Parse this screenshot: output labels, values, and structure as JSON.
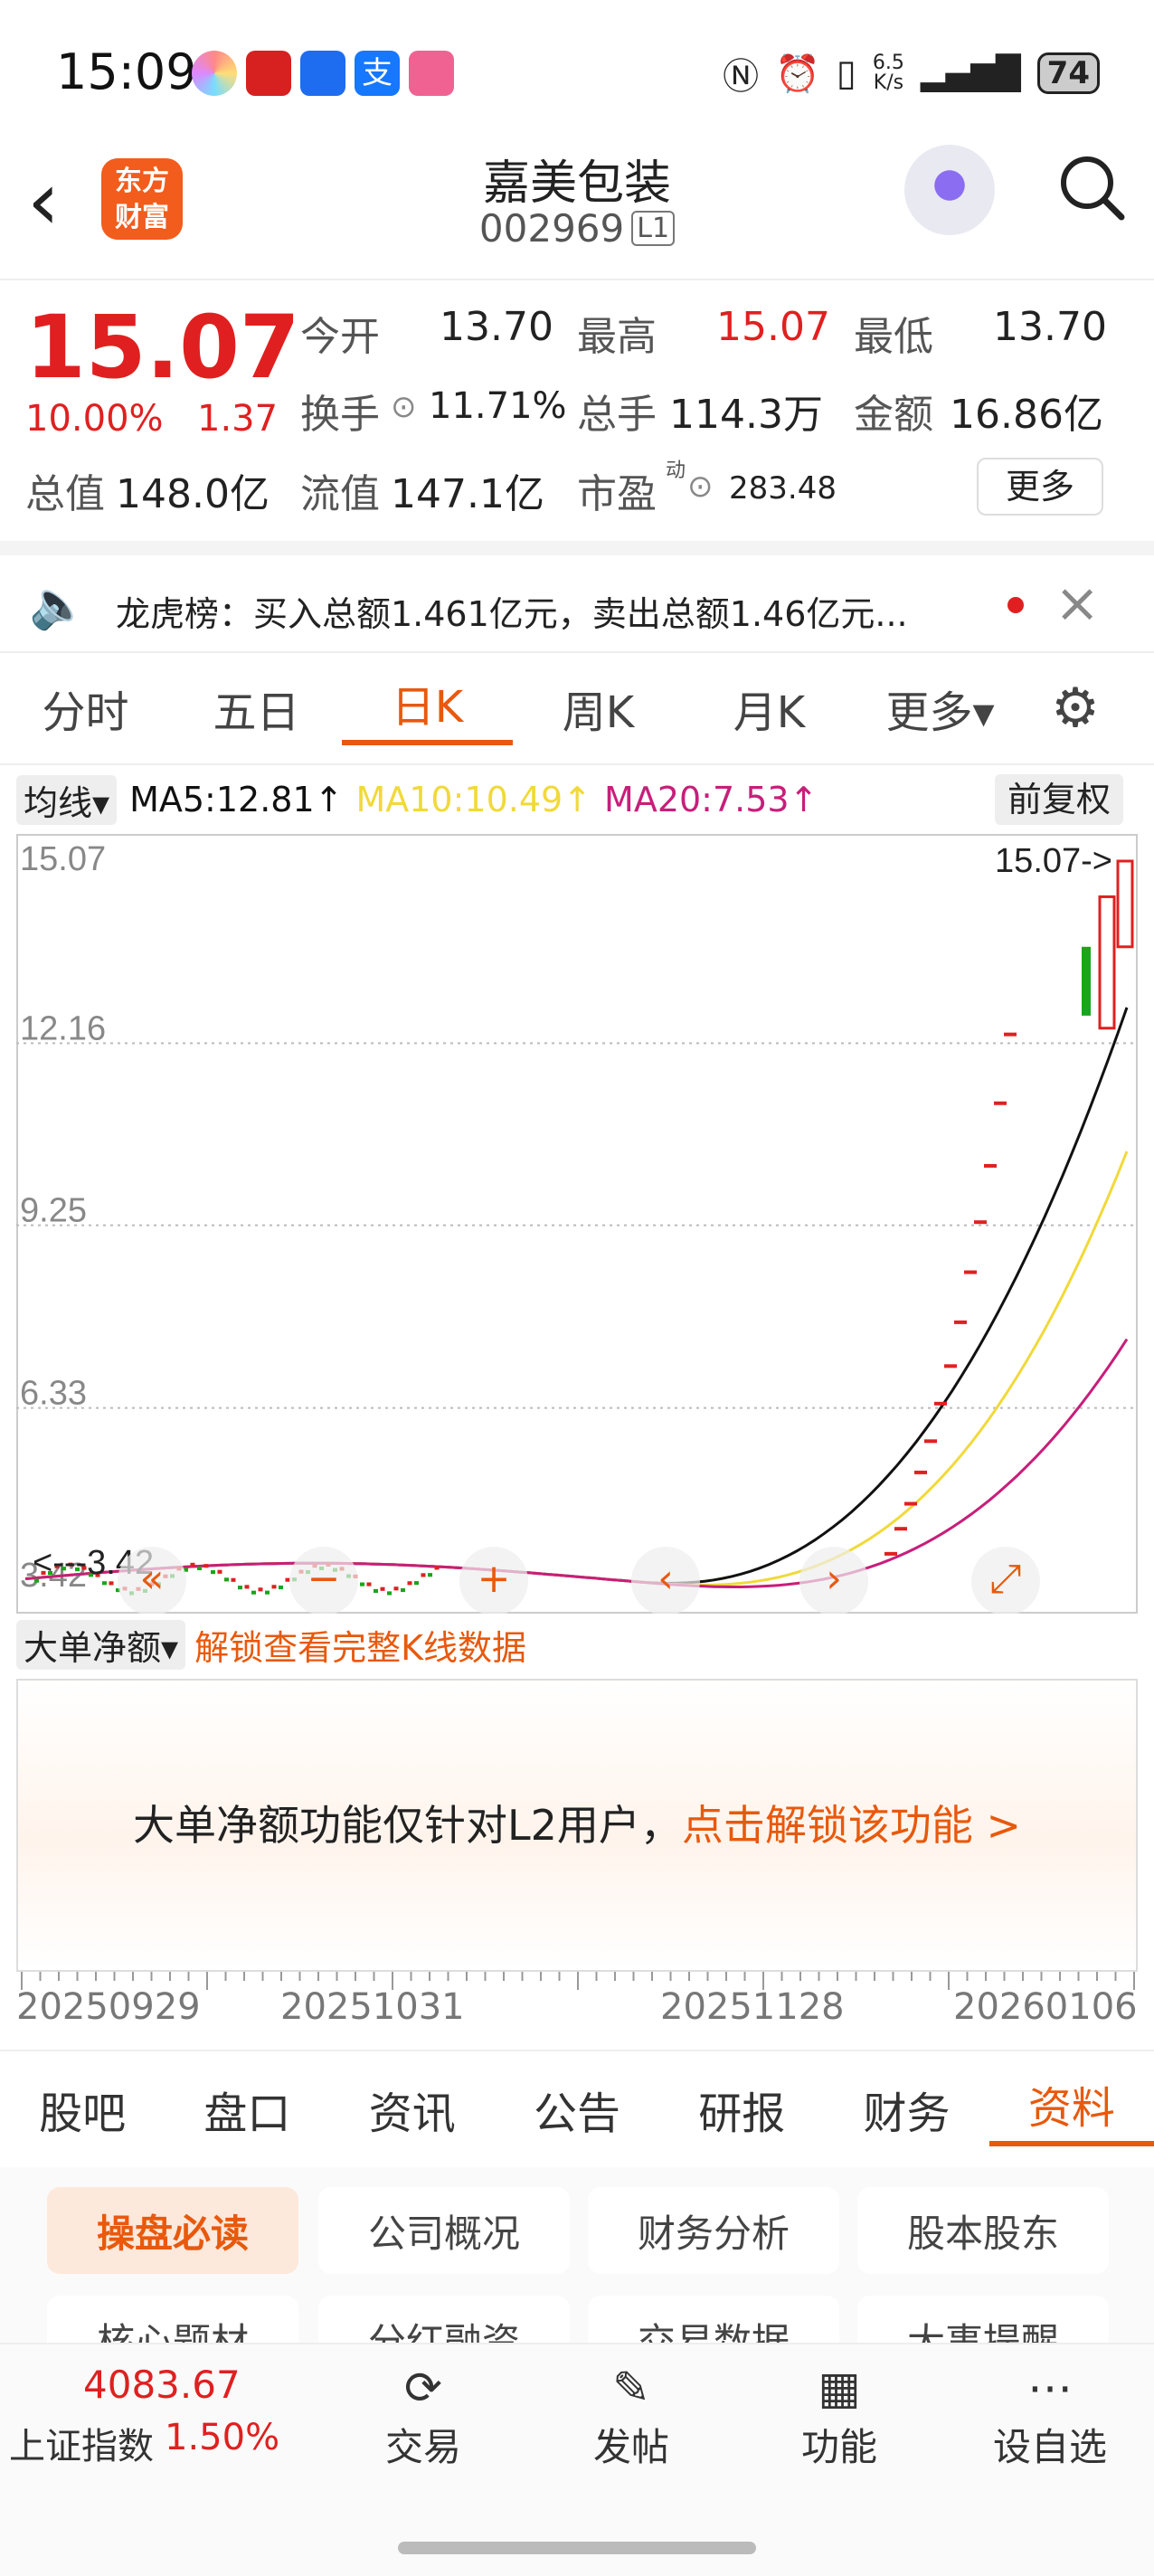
{
  "status_bar": {
    "time": "15:09",
    "net_speed_top": "6.5",
    "net_speed_bottom": "K/s",
    "battery": "74"
  },
  "header": {
    "title": "嘉美包装",
    "code": "002969",
    "level": "L1",
    "logo_line1": "东方",
    "logo_line2": "财富"
  },
  "quote": {
    "price": "15.07",
    "change_pct": "10.00%",
    "change": "1.37",
    "open_label": "今开",
    "open": "13.70",
    "high_label": "最高",
    "high": "15.07",
    "low_label": "最低",
    "low": "13.70",
    "turnover_label": "换手",
    "turnover": "11.71%",
    "volume_label": "总手",
    "volume": "114.3万",
    "amount_label": "金额",
    "amount": "16.86亿",
    "mktcap_label": "总值",
    "mktcap": "148.0亿",
    "float_label": "流值",
    "float_cap": "147.1亿",
    "pe_label": "市盈",
    "pe_sup": "动",
    "pe": "283.48",
    "more": "更多"
  },
  "lhb": {
    "text": "龙虎榜：买入总额1.461亿元，卖出总额1.46亿元..."
  },
  "tabs": [
    "分时",
    "五日",
    "日K",
    "周K",
    "月K",
    "更多▾"
  ],
  "ma": {
    "selector": "均线▾",
    "ma5": "MA5:12.81↑",
    "ma10": "MA10:10.49↑",
    "ma20": "MA20:7.53↑",
    "adjust": "前复权"
  },
  "chart_data": {
    "type": "candlestick",
    "y_ticks": [
      "15.07",
      "12.16",
      "9.25",
      "6.33",
      "3.42"
    ],
    "max_label": "15.07->",
    "min_label": "<---3.42",
    "ylim": [
      3.42,
      15.07
    ],
    "x_ticks": [
      "20250929",
      "20251031",
      "20251128",
      "20260106"
    ],
    "series": [
      {
        "name": "MA5",
        "value": "12.81"
      },
      {
        "name": "MA10",
        "value": "10.49"
      },
      {
        "name": "MA20",
        "value": "7.53"
      }
    ]
  },
  "colors": {
    "accent": "#e8590c",
    "up": "#e02020",
    "down": "#1aa51a",
    "ma5": "#111111",
    "ma10": "#f1d93a",
    "ma20": "#c81e7a"
  },
  "sub_chart": {
    "selector": "大单净额▾",
    "unlock_link": "解锁查看完整K线数据",
    "notice": "大单净额功能仅针对L2用户，",
    "notice_link": "点击解锁该功能 >"
  },
  "bottom_tabs": [
    "股吧",
    "盘口",
    "资讯",
    "公告",
    "研报",
    "财务",
    "资料"
  ],
  "info_buttons": [
    "操盘必读",
    "公司概况",
    "财务分析",
    "股本股东",
    "核心题材",
    "分红融资",
    "交易数据",
    "大事提醒"
  ],
  "footer": {
    "index_value": "4083.67",
    "index_name": "上证指数",
    "index_pct": "1.50%",
    "trade": "交易",
    "post": "发帖",
    "func": "功能",
    "watch": "设自选"
  }
}
